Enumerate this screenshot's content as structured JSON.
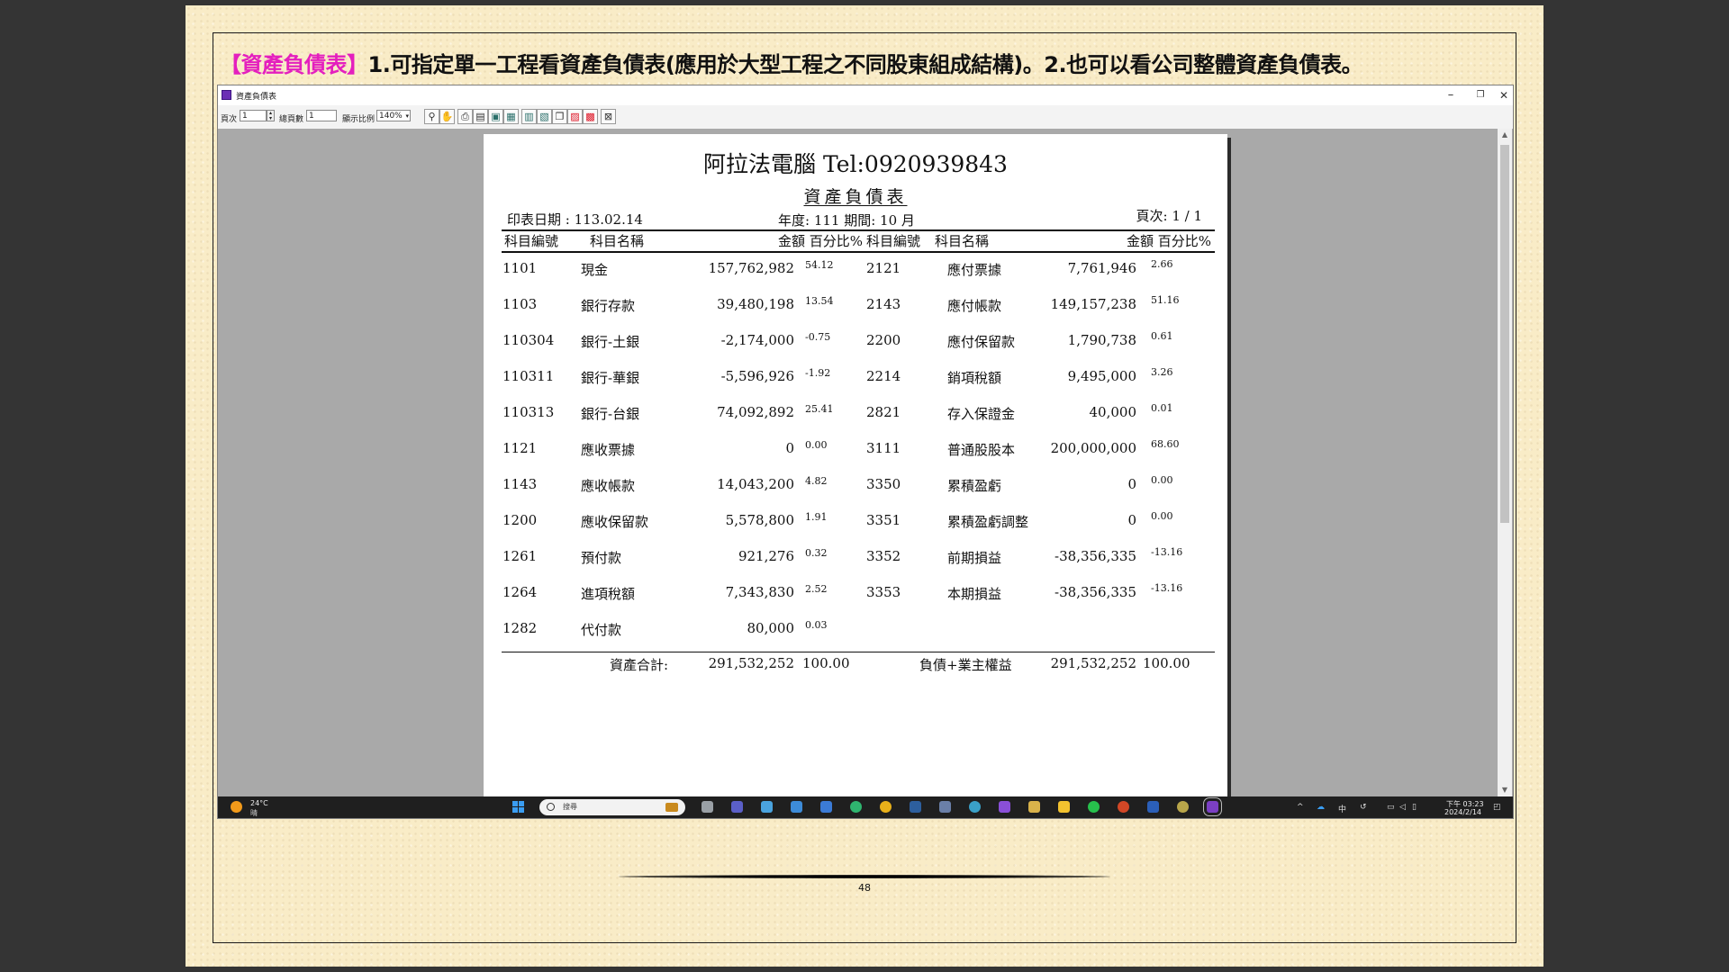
{
  "slide": {
    "heading_highlight": "【資產負債表】",
    "heading_rest": "1.可指定單一工程看資產負債表(應用於大型工程之不同股東組成結構)。2.也可以看公司整體資產負債表。",
    "page_number": "48"
  },
  "window": {
    "title": "資產負債表",
    "minimize": "–",
    "maximize": "❐",
    "close": "✕"
  },
  "toolbar": {
    "page_label": "頁次",
    "page_value": "1",
    "total_pages_label": "總頁數",
    "total_pages_value": "1",
    "zoom_label": "顯示比例",
    "zoom_value": "140%"
  },
  "report": {
    "company": "阿拉法電腦 Tel:0920939843",
    "title": "資產負債表",
    "print_date": "印表日期 : 113.02.14",
    "period": "年度: 111 期間: 10 月",
    "page": "頁次: 1 / 1",
    "headers": {
      "code": "科目編號",
      "name": "科目名稱",
      "amount_pct": "金額 百分比%"
    },
    "assets": [
      {
        "code": "1101",
        "name": "現金",
        "amount": "157,762,982",
        "pct": "54.12"
      },
      {
        "code": "1103",
        "name": "銀行存款",
        "amount": "39,480,198",
        "pct": "13.54"
      },
      {
        "code": "110304",
        "name": "銀行-土銀",
        "amount": "-2,174,000",
        "pct": "-0.75"
      },
      {
        "code": "110311",
        "name": "銀行-華銀",
        "amount": "-5,596,926",
        "pct": "-1.92"
      },
      {
        "code": "110313",
        "name": "銀行-台銀",
        "amount": "74,092,892",
        "pct": "25.41"
      },
      {
        "code": "1121",
        "name": "應收票據",
        "amount": "0",
        "pct": "0.00"
      },
      {
        "code": "1143",
        "name": "應收帳款",
        "amount": "14,043,200",
        "pct": "4.82"
      },
      {
        "code": "1200",
        "name": "應收保留款",
        "amount": "5,578,800",
        "pct": "1.91"
      },
      {
        "code": "1261",
        "name": "預付款",
        "amount": "921,276",
        "pct": "0.32"
      },
      {
        "code": "1264",
        "name": "進項稅額",
        "amount": "7,343,830",
        "pct": "2.52"
      },
      {
        "code": "1282",
        "name": "代付款",
        "amount": "80,000",
        "pct": "0.03"
      }
    ],
    "liabilities": [
      {
        "code": "2121",
        "name": "應付票據",
        "amount": "7,761,946",
        "pct": "2.66"
      },
      {
        "code": "2143",
        "name": "應付帳款",
        "amount": "149,157,238",
        "pct": "51.16"
      },
      {
        "code": "2200",
        "name": "應付保留款",
        "amount": "1,790,738",
        "pct": "0.61"
      },
      {
        "code": "2214",
        "name": "銷項稅額",
        "amount": "9,495,000",
        "pct": "3.26"
      },
      {
        "code": "2821",
        "name": "存入保證金",
        "amount": "40,000",
        "pct": "0.01"
      },
      {
        "code": "3111",
        "name": "普通股股本",
        "amount": "200,000,000",
        "pct": "68.60"
      },
      {
        "code": "3350",
        "name": "累積盈虧",
        "amount": "0",
        "pct": "0.00"
      },
      {
        "code": "3351",
        "name": "累積盈虧調整",
        "amount": "0",
        "pct": "0.00"
      },
      {
        "code": "3352",
        "name": "前期損益",
        "amount": "-38,356,335",
        "pct": "-13.16"
      },
      {
        "code": "3353",
        "name": "本期損益",
        "amount": "-38,356,335",
        "pct": "-13.16"
      }
    ],
    "totals": {
      "assets_label": "資產合計:",
      "assets_amount": "291,532,252",
      "assets_pct": "100.00",
      "liab_label": "負債+業主權益",
      "liab_amount": "291,532,252",
      "liab_pct": "100.00"
    }
  },
  "taskbar": {
    "weather_temp": "24°C",
    "weather_cond": "晴",
    "search_placeholder": "搜尋",
    "ime": "中",
    "time": "下午 03:23",
    "date": "2024/2/14",
    "apps": [
      {
        "name": "task-view",
        "color": "#9aa0a6"
      },
      {
        "name": "teams",
        "color": "#5b5fc7"
      },
      {
        "name": "notepad",
        "color": "#4aa3df"
      },
      {
        "name": "photos",
        "color": "#3d8bd8"
      },
      {
        "name": "store",
        "color": "#3b7bd6"
      },
      {
        "name": "edge",
        "color": "#2fb56f"
      },
      {
        "name": "chrome",
        "color": "#e8b01a"
      },
      {
        "name": "app-blue",
        "color": "#2d5f9e"
      },
      {
        "name": "mail",
        "color": "#6a7fa8"
      },
      {
        "name": "browser",
        "color": "#3aa0c8"
      },
      {
        "name": "visual-studio",
        "color": "#8a4fd8"
      },
      {
        "name": "tools",
        "color": "#d9b24a"
      },
      {
        "name": "explorer",
        "color": "#f2c22f"
      },
      {
        "name": "line",
        "color": "#27c04c"
      },
      {
        "name": "powerpoint",
        "color": "#d24726"
      },
      {
        "name": "word",
        "color": "#2b5fb8"
      },
      {
        "name": "app-round",
        "color": "#b9a64a"
      },
      {
        "name": "report-app",
        "color": "#7b3fc4"
      }
    ]
  }
}
